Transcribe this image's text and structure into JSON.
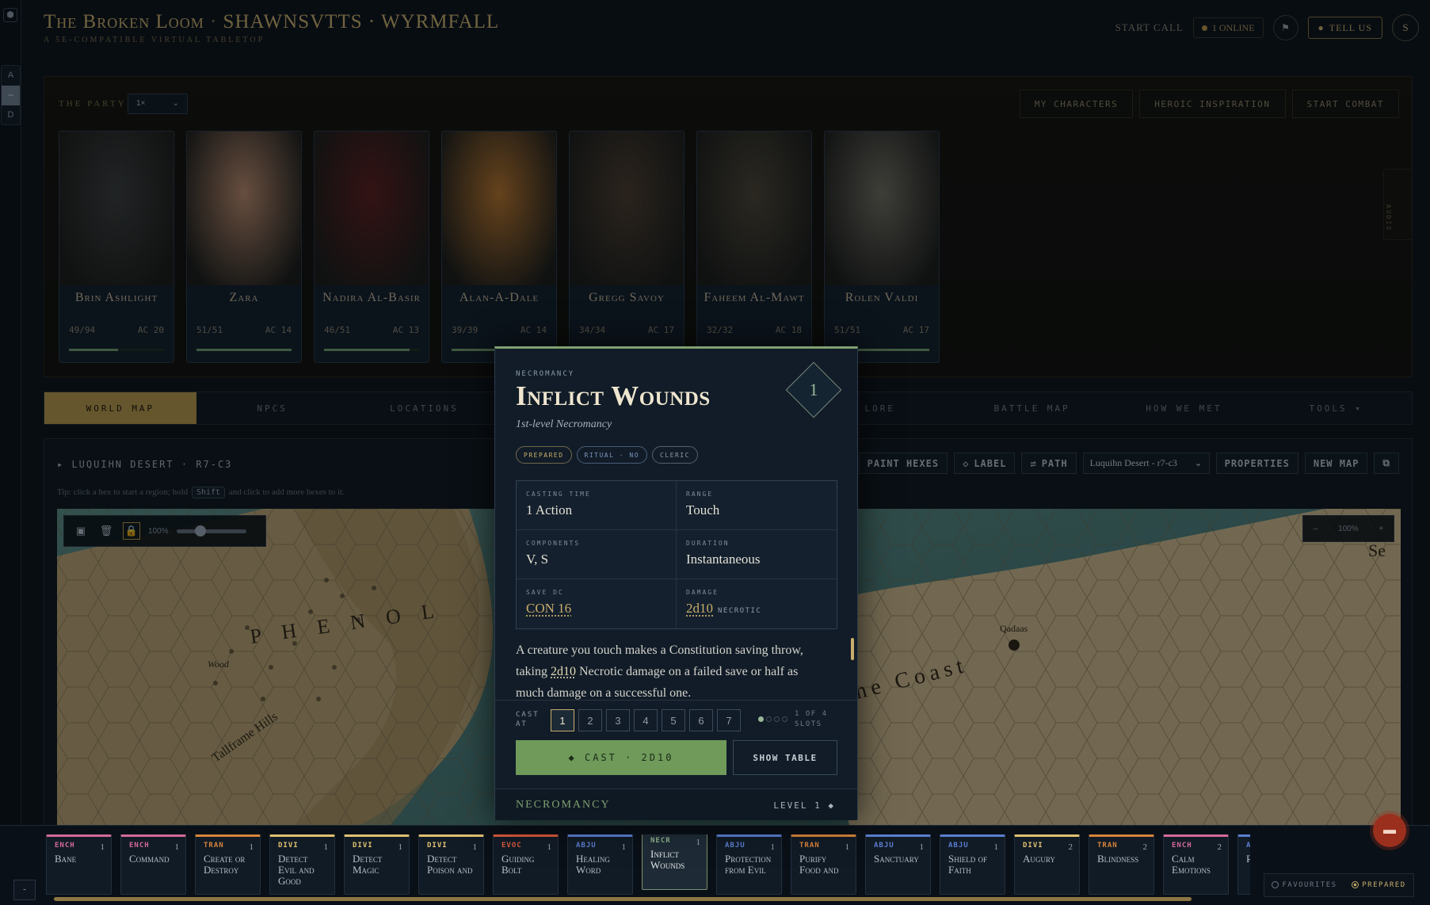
{
  "app": {
    "title": "The Broken Loom",
    "sep": "·",
    "campaign": "SHAWNSVTTS · WYRMFALL",
    "subtitle": "A 5E-COMPATIBLE VIRTUAL TABLETOP"
  },
  "leftrail": {
    "logo": "⬢",
    "buttons": [
      "A",
      "–",
      "D"
    ],
    "bottom": "-"
  },
  "header": {
    "start_call": "START CALL",
    "online": "1 ONLINE",
    "flag_icon": "⚑",
    "tell_us": "TELL US",
    "avatar": "S"
  },
  "party": {
    "label": "THE PARTY",
    "select": "1×",
    "actions": [
      "MY CHARACTERS",
      "HEROIC INSPIRATION",
      "START COMBAT"
    ],
    "side_tab": "AUDIO",
    "characters": [
      {
        "name": "Brin Ashlight",
        "hp": "49/94",
        "ac": "AC 20",
        "hp_fraction": 0.52,
        "color": "#3a3b3a"
      },
      {
        "name": "Zara",
        "hp": "51/51",
        "ac": "AC 14",
        "hp_fraction": 1.0,
        "color": "#b8876a"
      },
      {
        "name": "Nadira Al-Basir",
        "hp": "46/51",
        "ac": "AC 13",
        "hp_fraction": 0.9,
        "color": "#5a1c1c"
      },
      {
        "name": "Alan-A-Dale",
        "hp": "39/39",
        "ac": "AC 14",
        "hp_fraction": 1.0,
        "color": "#b5722b"
      },
      {
        "name": "Gregg Savoy",
        "hp": "34/34",
        "ac": "AC 17",
        "hp_fraction": 1.0,
        "color": "#4a3a2c"
      },
      {
        "name": "Faheem Al-Mawt",
        "hp": "32/32",
        "ac": "AC 18",
        "hp_fraction": 1.0,
        "color": "#4a4234"
      },
      {
        "name": "Rolen Valdi",
        "hp": "51/51",
        "ac": "AC 17",
        "hp_fraction": 1.0,
        "color": "#6e6a5e"
      }
    ]
  },
  "nav": {
    "tabs": [
      "WORLD MAP",
      "NPCS",
      "LOCATIONS",
      "",
      "",
      "LORE",
      "BATTLE MAP",
      "HOW WE MET",
      "TOOLS ▾"
    ]
  },
  "map": {
    "location": "▸ LUQUIHN DESERT · R7-C3",
    "tip_before": "Tip: click a hex to start a region; hold",
    "tip_key": "Shift",
    "tip_after": "and click to add more hexes to it.",
    "tools": [
      "PAINT HEXES",
      "LABEL",
      "PATH"
    ],
    "select_value": "Luquihn Desert - r7-c3",
    "tools_right": [
      "PROPERTIES",
      "NEW MAP"
    ],
    "zoom_label": "100%",
    "zoom_fraction": 0.35,
    "zoom_ctrl": {
      "minus": "–",
      "value": "100%",
      "plus": "+"
    },
    "labels": [
      "P H E N O L",
      "Tallframe Hills",
      "Wood",
      "Qadaas",
      "ne Coast",
      "Se"
    ]
  },
  "spell": {
    "school_tag": "NECROMANCY",
    "name": "Inflict Wounds",
    "subtitle": "1st-level Necromancy",
    "level_badge": "1",
    "tags": [
      {
        "label": "PREPARED",
        "color": "#c9ad6c"
      },
      {
        "label": "RITUAL · NO",
        "color": "#7f94c0"
      },
      {
        "label": "CLERIC",
        "color": "#8f9aa6"
      }
    ],
    "stats": [
      {
        "label": "CASTING TIME",
        "value": "1 Action",
        "unit": ""
      },
      {
        "label": "RANGE",
        "value": "Touch",
        "unit": ""
      },
      {
        "label": "COMPONENTS",
        "value": "V, S",
        "unit": ""
      },
      {
        "label": "DURATION",
        "value": "Instantaneous",
        "unit": ""
      },
      {
        "label": "SAVE DC",
        "value": "CON 16",
        "unit": ""
      },
      {
        "label": "DAMAGE",
        "value": "2d10",
        "unit": "NECROTIC"
      }
    ],
    "desc_1": "A creature you touch makes a Constitution saving throw, taking",
    "desc_dice": "2d10",
    "desc_2": "Necrotic damage on a failed save or half as much damage on a successful one.",
    "cast_at_label": "CAST AT",
    "cast_levels": [
      "1",
      "2",
      "3",
      "4",
      "5",
      "6",
      "7"
    ],
    "slots_text": "1 OF 4 SLOTS",
    "slots_total": 4,
    "slots_filled": 1,
    "cast_button": "◆ CAST · 2D10",
    "show_table": "SHOW TABLE",
    "footer_school": "NECROMANCY",
    "footer_level": "LEVEL 1 ◆"
  },
  "tray": {
    "spells": [
      {
        "school": "ENCH",
        "level": "1",
        "name": "Bane",
        "color": "#d46a9a"
      },
      {
        "school": "ENCH",
        "level": "1",
        "name": "Command",
        "color": "#d46a9a"
      },
      {
        "school": "TRAN",
        "level": "1",
        "name": "Create or Destroy",
        "color": "#d8843a"
      },
      {
        "school": "DIVI",
        "level": "1",
        "name": "Detect Evil and Good",
        "color": "#e0c070"
      },
      {
        "school": "DIVI",
        "level": "1",
        "name": "Detect Magic",
        "color": "#e0c070"
      },
      {
        "school": "DIVI",
        "level": "1",
        "name": "Detect Poison and",
        "color": "#e0c070"
      },
      {
        "school": "EVOC",
        "level": "1",
        "name": "Guiding Bolt",
        "color": "#d95a3a"
      },
      {
        "school": "ABJU",
        "level": "1",
        "name": "Healing Word",
        "color": "#5a7ed0"
      },
      {
        "school": "NECR",
        "level": "1",
        "name": "Inflict Wounds",
        "color": "#8fb08a"
      },
      {
        "school": "ABJU",
        "level": "1",
        "name": "Protection from Evil",
        "color": "#5a7ed0"
      },
      {
        "school": "TRAN",
        "level": "1",
        "name": "Purify Food and",
        "color": "#d8843a"
      },
      {
        "school": "ABJU",
        "level": "1",
        "name": "Sanctuary",
        "color": "#5a7ed0"
      },
      {
        "school": "ABJU",
        "level": "1",
        "name": "Shield of Faith",
        "color": "#5a7ed0"
      },
      {
        "school": "DIVI",
        "level": "2",
        "name": "Augury",
        "color": "#e0c070"
      },
      {
        "school": "TRAN",
        "level": "2",
        "name": "Blindness",
        "color": "#d8843a"
      },
      {
        "school": "ENCH",
        "level": "2",
        "name": "Calm Emotions",
        "color": "#d46a9a"
      },
      {
        "school": "A",
        "level": "",
        "name": "R C",
        "color": "#5a7ed0"
      }
    ],
    "filters": [
      "FAVOURITES",
      "PREPARED"
    ]
  }
}
